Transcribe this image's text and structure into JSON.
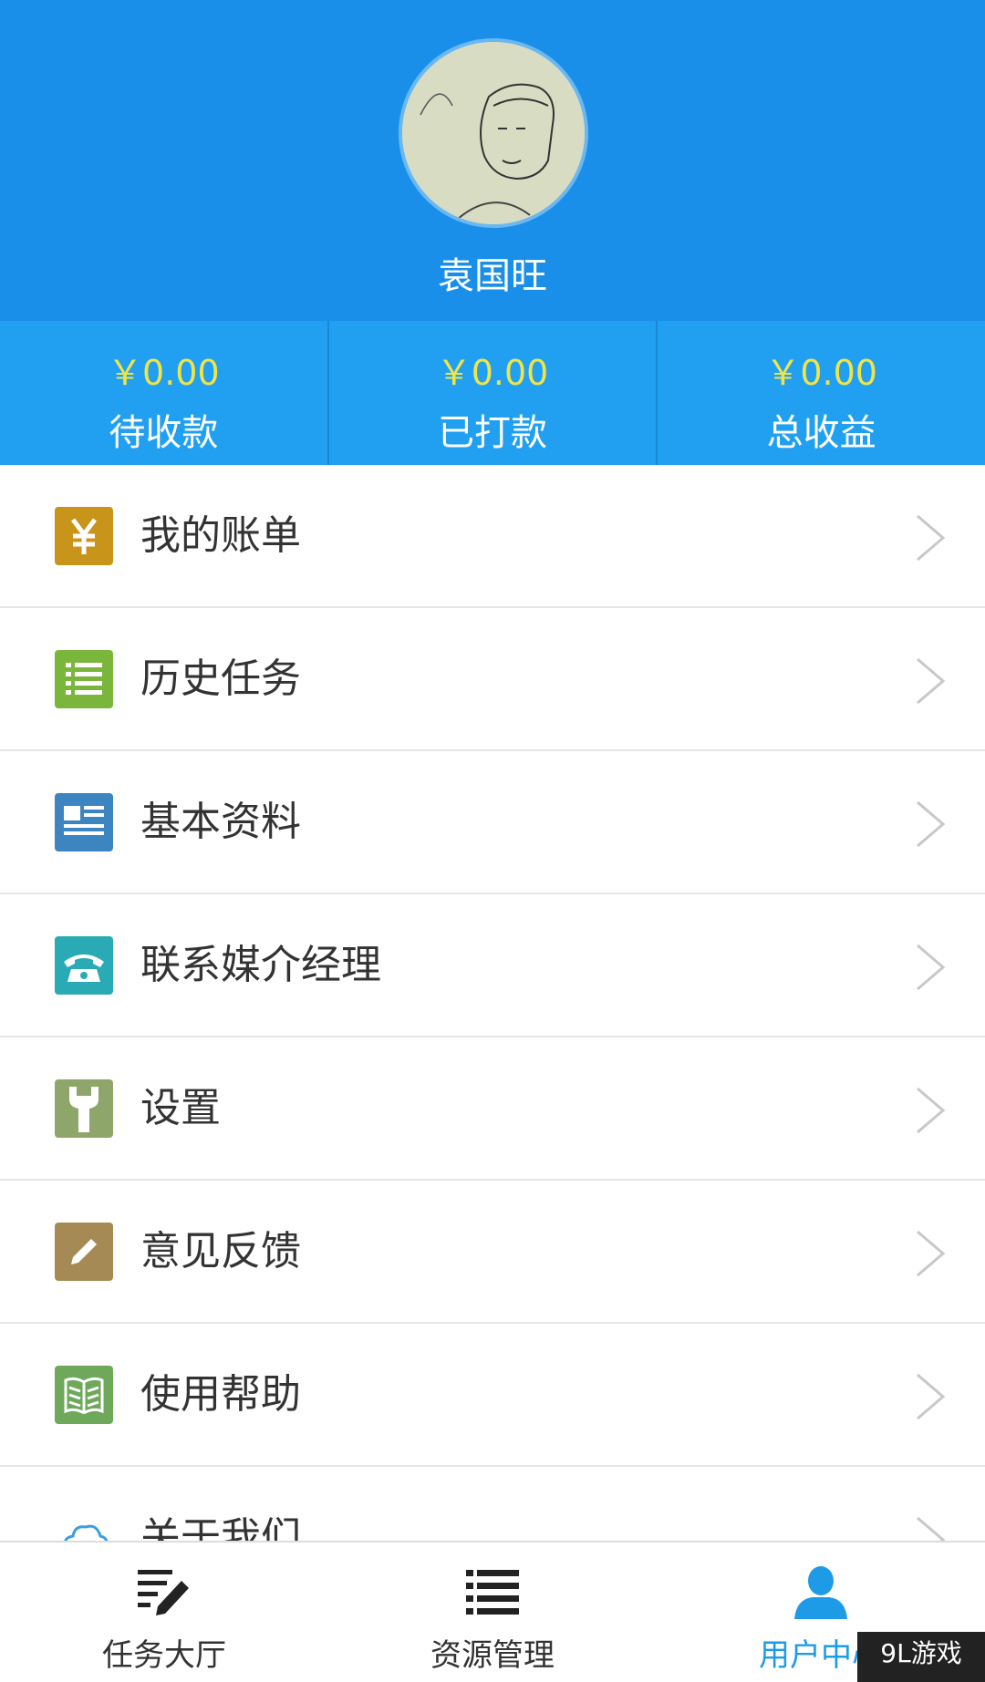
{
  "profile": {
    "username": "袁国旺",
    "avatar_icon": "sketch-portrait-avatar"
  },
  "stats": [
    {
      "amount": "￥0.00",
      "label": "待收款"
    },
    {
      "amount": "￥0.00",
      "label": "已打款"
    },
    {
      "amount": "￥0.00",
      "label": "总收益"
    }
  ],
  "menu": {
    "items": [
      {
        "label": "我的账单",
        "icon": "yuan-icon",
        "color": "#c8951a"
      },
      {
        "label": "历史任务",
        "icon": "list-icon",
        "color": "#7ab63c"
      },
      {
        "label": "基本资料",
        "icon": "profile-card-icon",
        "color": "#3d85c1"
      },
      {
        "label": "联系媒介经理",
        "icon": "phone-icon",
        "color": "#2aaab5"
      },
      {
        "label": "设置",
        "icon": "wrench-icon",
        "color": "#8fa66a"
      },
      {
        "label": "意见反馈",
        "icon": "pencil-icon",
        "color": "#a58a56"
      },
      {
        "label": "使用帮助",
        "icon": "book-icon",
        "color": "#6ea85a"
      },
      {
        "label": "关于我们",
        "icon": "cloud-icon",
        "color": "#3a9de0"
      }
    ]
  },
  "bottom_nav": {
    "tabs": [
      {
        "label": "任务大厅",
        "icon": "edit-list-icon",
        "active": false
      },
      {
        "label": "资源管理",
        "icon": "list-icon",
        "active": false
      },
      {
        "label": "用户中心",
        "icon": "user-icon",
        "active": true
      }
    ]
  },
  "watermark": "9L游戏",
  "colors": {
    "header": "#1a8fe9",
    "stats_bar": "#21a0f2",
    "amount": "#f2e445",
    "active_tab": "#1e9be6"
  }
}
